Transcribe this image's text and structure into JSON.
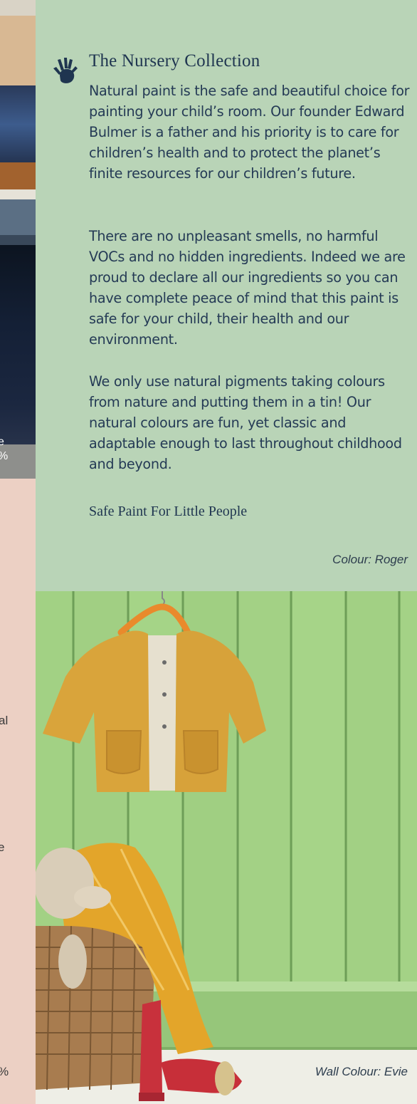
{
  "collection": {
    "title": "The Nursery Collection",
    "icon": "hand-print-icon",
    "paragraphs": [
      "Natural paint is the safe and beautiful choice for painting your child’s room. Our founder Edward Bulmer is a father and his priority is to care for children’s health and to protect the planet’s finite resources for our children’s future.",
      "There are no unpleasant smells, no harmful VOCs and no hidden ingredients. Indeed we are proud to declare all our ingredients so you can have complete peace of mind that this paint is safe for your child, their health and our environment.",
      "We only use natural pigments taking colours from nature and putting them in a tin! Our natural colours are fun, yet classic and adaptable enough to last throughout childhood and beyond."
    ],
    "tagline": "Safe Paint For Little People",
    "colour_caption": "Colour: Roger"
  },
  "photo": {
    "caption": "Wall Colour: Evie"
  },
  "left_strip": {
    "fragments": [
      "e",
      "%",
      "al",
      "e",
      "%"
    ]
  },
  "colors": {
    "panel_background": "#b9d4b7",
    "text": "#243a55",
    "left_strip_background": "#ecd0c4",
    "wall_green": "#9ccc7e"
  }
}
